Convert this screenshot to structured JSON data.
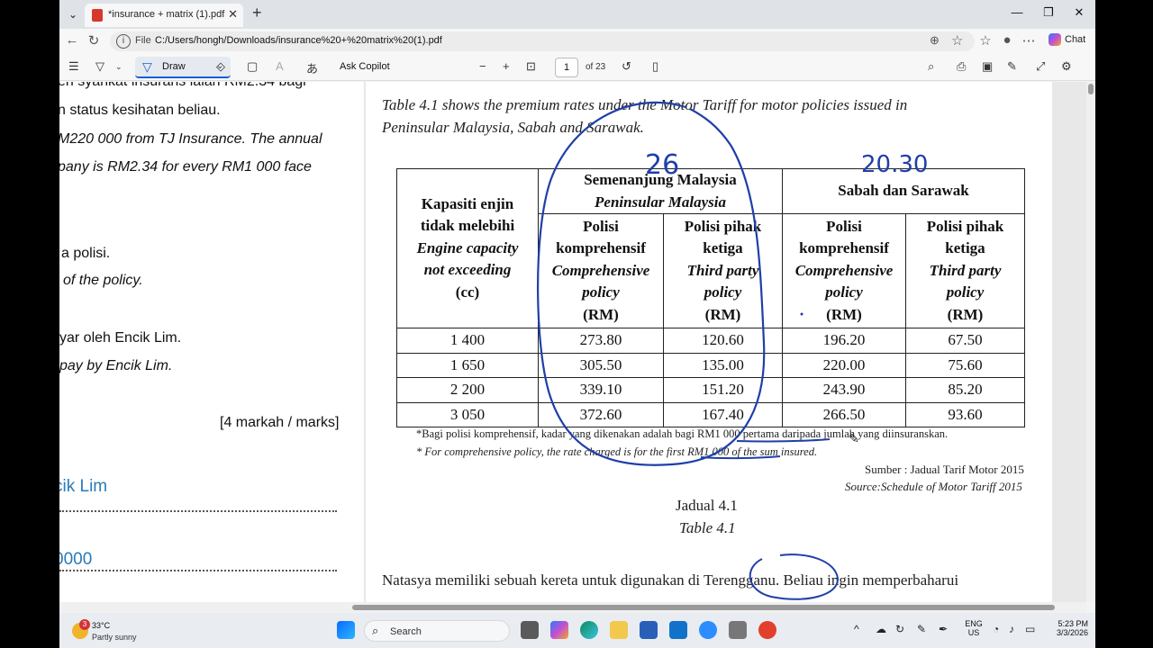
{
  "browser": {
    "tab_title": "*insurance + matrix (1).pdf",
    "address_label": "File",
    "url": "C:/Users/hongh/Downloads/insurance%20+%20matrix%20(1).pdf",
    "chat_label": "Chat"
  },
  "pdf_toolbar": {
    "draw_label": "Draw",
    "ask_copilot_label": "Ask Copilot",
    "page_number": "1",
    "page_count": "of 23"
  },
  "left_page": {
    "lines": [
      "en syarikat insurans ialah RM2.34 bagi",
      "n status kesihatan beliau.",
      "M220 000 from TJ Insurance. The annual",
      "pany is RM2.34 for every RM1 000 face",
      "a polisi.",
      "of the policy.",
      "yar oleh Encik Lim.",
      "pay by Encik Lim.",
      "[4 markah / marks]"
    ],
    "handwritten_1": "cik Lim",
    "handwritten_2": "0000"
  },
  "right_page": {
    "intro_1": "Table 4.1 shows the premium rates under the Motor Tariff for motor policies issued in",
    "intro_2": "Peninsular Malaysia, Sabah and Sarawak.",
    "table": {
      "col_engine": [
        "Kapasiti enjin",
        "tidak melebihi",
        "Engine capacity",
        "not exceeding",
        "(cc)"
      ],
      "region_1": [
        "Semenanjung Malaysia",
        "Peninsular Malaysia"
      ],
      "region_2": "Sabah dan Sarawak",
      "sub_comp": [
        "Polisi",
        "komprehensif",
        "Comprehensive",
        "policy",
        "(RM)"
      ],
      "sub_third": [
        "Polisi pihak",
        "ketiga",
        "Third party",
        "policy",
        "(RM)"
      ],
      "rows": [
        [
          "1 400",
          "273.80",
          "120.60",
          "196.20",
          "67.50"
        ],
        [
          "1 650",
          "305.50",
          "135.00",
          "220.00",
          "75.60"
        ],
        [
          "2 200",
          "339.10",
          "151.20",
          "243.90",
          "85.20"
        ],
        [
          "3 050",
          "372.60",
          "167.40",
          "266.50",
          "93.60"
        ]
      ]
    },
    "note_ms": "*Bagi polisi komprehensif, kadar yang dikenakan adalah bagi RM1 000 pertama daripada jumlah yang diinsuranskan.",
    "note_en": "* For comprehensive policy, the rate charged is for the first RM1 000 of the sum insured.",
    "source_ms": "Sumber : Jadual Tarif Motor 2015",
    "source_en": "Source:Schedule of Motor Tariff 2015",
    "caption_ms": "Jadual 4.1",
    "caption_en": "Table 4.1",
    "bottom_line": "Natasya memiliki sebuah kereta untuk digunakan di Terengganu. Beliau ingin memperbaharui",
    "ink_1": "26",
    "ink_2": "20.30"
  },
  "taskbar": {
    "weather_temp": "33°C",
    "weather_desc": "Partly sunny",
    "weather_badge": "3",
    "search_label": "Search",
    "lang_1": "ENG",
    "lang_2": "US",
    "time": "5:23 PM",
    "date": "3/3/2026"
  }
}
